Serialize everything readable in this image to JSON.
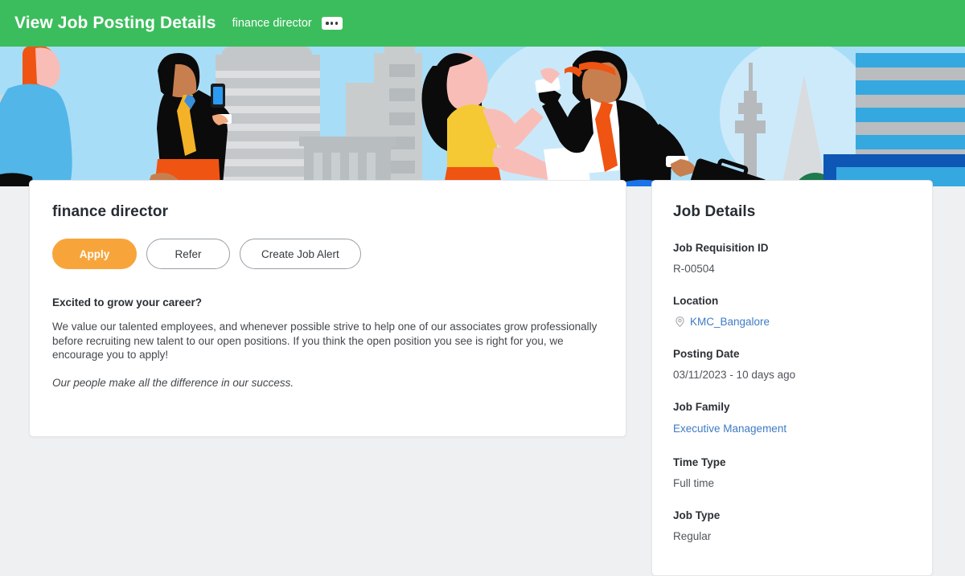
{
  "header": {
    "title": "View Job Posting Details",
    "subtitle": "finance director",
    "related_actions_icon": "ellipsis-icon",
    "background_color": "#3cbd5d",
    "text_color": "#ffffff"
  },
  "banner": {
    "alt": "illustration of business people walking in a city",
    "sky_color": "#a8ddf7",
    "building_gray": "#c9ccce",
    "accent_orange": "#ef5413",
    "accent_blue": "#1a73e8"
  },
  "main_card": {
    "job_title": "finance director",
    "buttons": [
      {
        "label": "Apply",
        "style": "primary",
        "color": "#f7a53b"
      },
      {
        "label": "Refer",
        "style": "outline"
      },
      {
        "label": "Create Job Alert",
        "style": "outline"
      }
    ],
    "section_heading": "Excited to grow your career?",
    "paragraph": "We value our talented employees, and whenever possible strive to help one of our associates grow professionally before recruiting new talent to our open positions. If you think the open position you see is right for you, we encourage you to apply!",
    "italic_line": "Our people make all the difference in our success."
  },
  "side_card": {
    "title": "Job Details",
    "details": [
      {
        "label": "Job Requisition ID",
        "value": "R-00504",
        "type": "text"
      },
      {
        "label": "Location",
        "value": "KMC_Bangalore",
        "type": "link",
        "icon": "location-pin-icon"
      },
      {
        "label": "Posting Date",
        "value": "03/11/2023 - 10 days ago",
        "type": "text"
      },
      {
        "label": "Job Family",
        "value": "Executive Management",
        "type": "link"
      },
      {
        "label": "Time Type",
        "value": "Full time",
        "type": "text"
      },
      {
        "label": "Job Type",
        "value": "Regular",
        "type": "text"
      }
    ],
    "link_color": "#3e7bc4"
  },
  "page": {
    "background_color": "#eef0f2"
  }
}
